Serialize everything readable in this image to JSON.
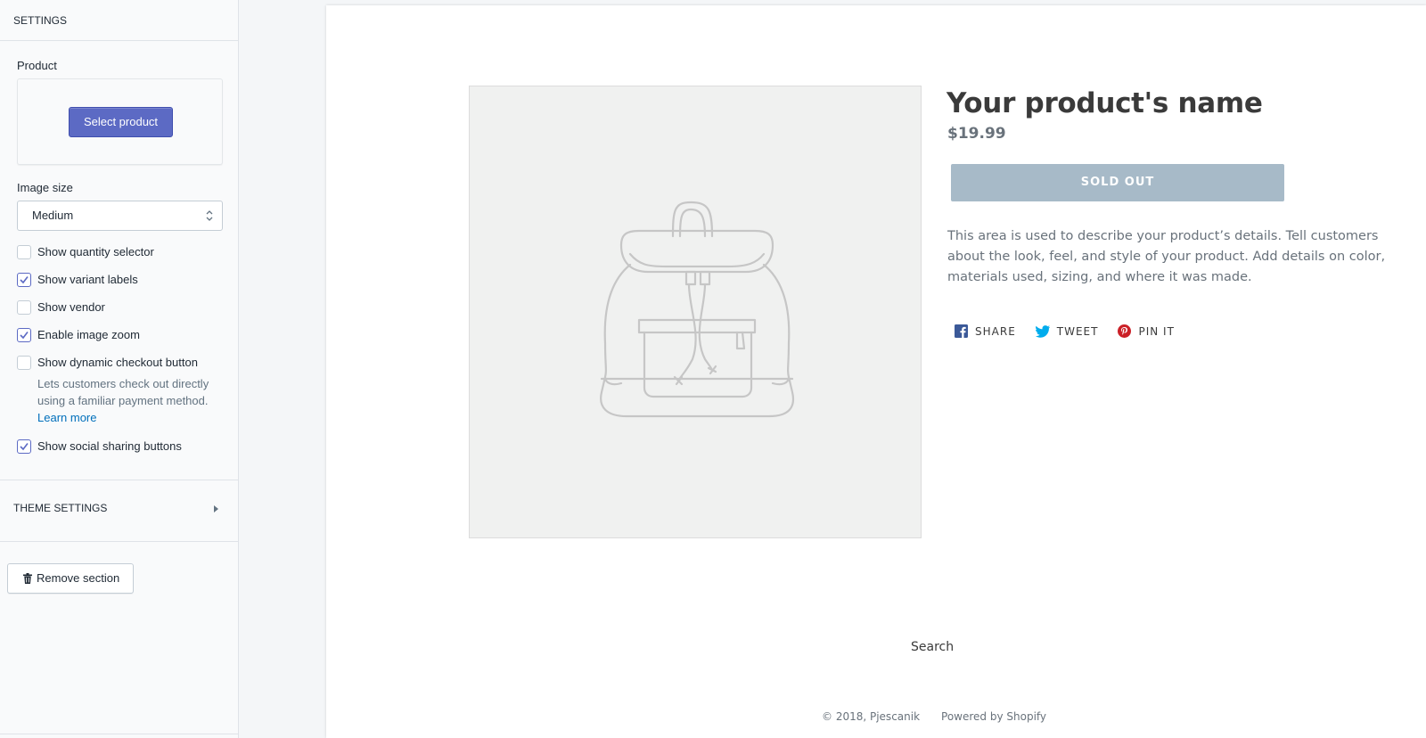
{
  "sidebar": {
    "header": "SETTINGS",
    "product_label": "Product",
    "select_product_label": "Select product",
    "image_size_label": "Image size",
    "image_size_value": "Medium",
    "checkboxes": [
      {
        "label": "Show quantity selector",
        "checked": false
      },
      {
        "label": "Show variant labels",
        "checked": true
      },
      {
        "label": "Show vendor",
        "checked": false
      },
      {
        "label": "Enable image zoom",
        "checked": true
      },
      {
        "label": "Show dynamic checkout button",
        "checked": false
      },
      {
        "label": "Show social sharing buttons",
        "checked": true
      }
    ],
    "dynamic_checkout_help": "Lets customers check out directly using a familiar payment method.",
    "learn_more": "Learn more",
    "theme_settings": "THEME SETTINGS",
    "remove_section": "Remove section"
  },
  "preview": {
    "product_name": "Your product's name",
    "price": "$19.99",
    "sold_out": "SOLD OUT",
    "description": "This area is used to describe your product’s details. Tell customers about the look, feel, and style of your product. Add details on color, materials used, sizing, and where it was made.",
    "share": "SHARE",
    "tweet": "TWEET",
    "pin": "PIN IT",
    "footer_search": "Search",
    "copyright": "© 2018, Pjescanik",
    "powered_by": "Powered by Shopify"
  },
  "colors": {
    "primary_button": "#5c6ac4",
    "sold_out_button": "#a7bac8",
    "link": "#006fbb",
    "facebook": "#3b5998",
    "twitter": "#00aced",
    "pinterest": "#cb2027"
  }
}
